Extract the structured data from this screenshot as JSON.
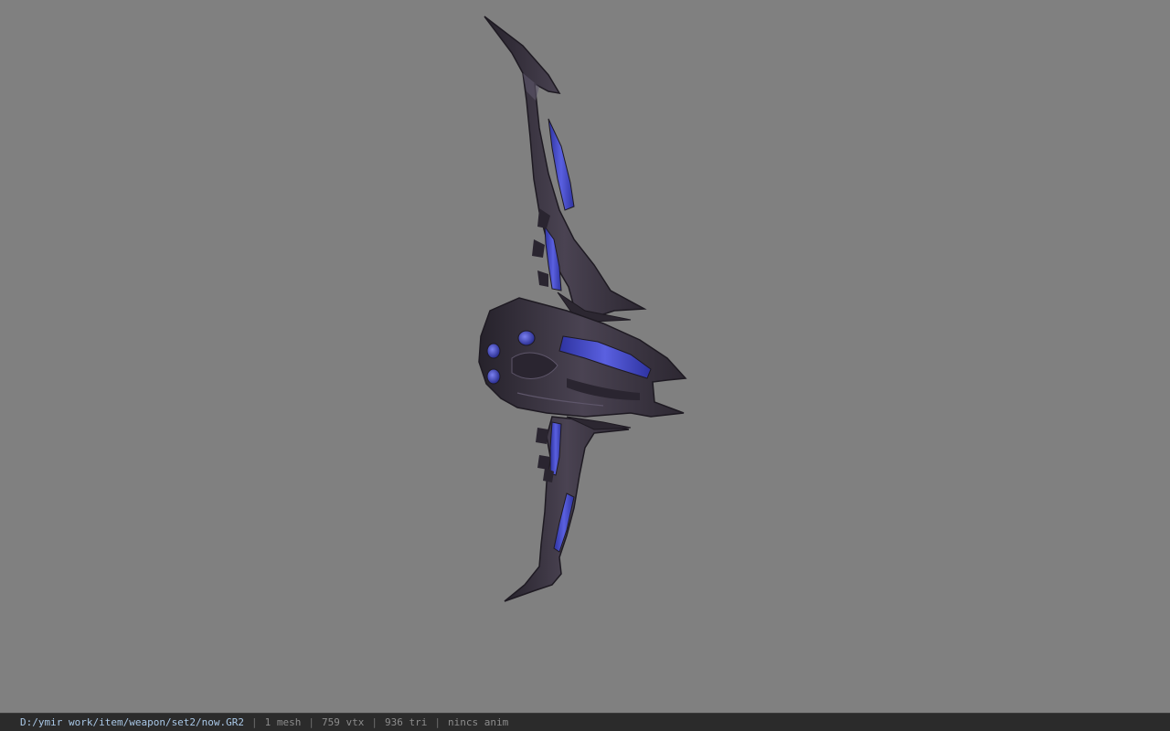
{
  "viewport": {
    "background": "#808080",
    "model": {
      "body_color": "#3d3744",
      "dark_color": "#25212a",
      "highlight_color": "#5e566a",
      "glow_color": "#4a4ec8"
    }
  },
  "statusbar": {
    "path": "D:/ymir work/item/weapon/set2/now.GR2",
    "separator": "|",
    "mesh": "1 mesh",
    "vertices": "759 vtx",
    "triangles": "936 tri",
    "animation": "nincs anim"
  }
}
